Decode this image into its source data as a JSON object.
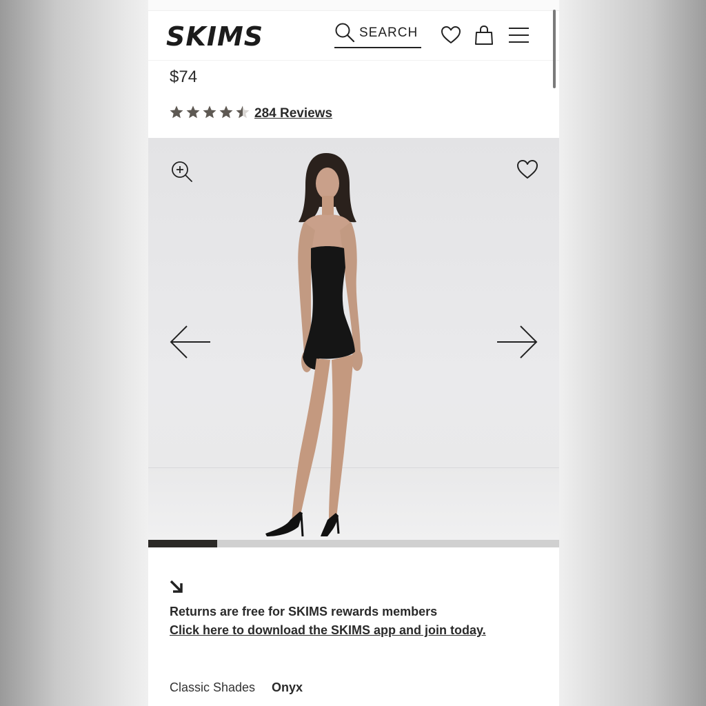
{
  "header": {
    "logo_text": "SKIMS",
    "search_label": "SEARCH",
    "icons": [
      "search-icon",
      "heart-icon",
      "shopping-bag-icon",
      "menu-icon"
    ]
  },
  "product": {
    "price": "$74",
    "rating": 4.5,
    "reviews_label": "284 Reviews"
  },
  "gallery": {
    "icons": [
      "zoom-in-icon",
      "heart-icon",
      "arrow-left-icon",
      "arrow-right-icon"
    ],
    "progress_fraction": 0.167
  },
  "promo": {
    "icon": "arrow-down-right-icon",
    "line1": "Returns are free for SKIMS rewards members",
    "line2": "Click here to download the SKIMS app and join today."
  },
  "shade": {
    "label": "Classic Shades",
    "value": "Onyx"
  },
  "colors": {
    "text": "#2a2a2a",
    "star": "#5e5953",
    "progress_active": "#2b2926",
    "progress_track": "#d0d0d0"
  }
}
